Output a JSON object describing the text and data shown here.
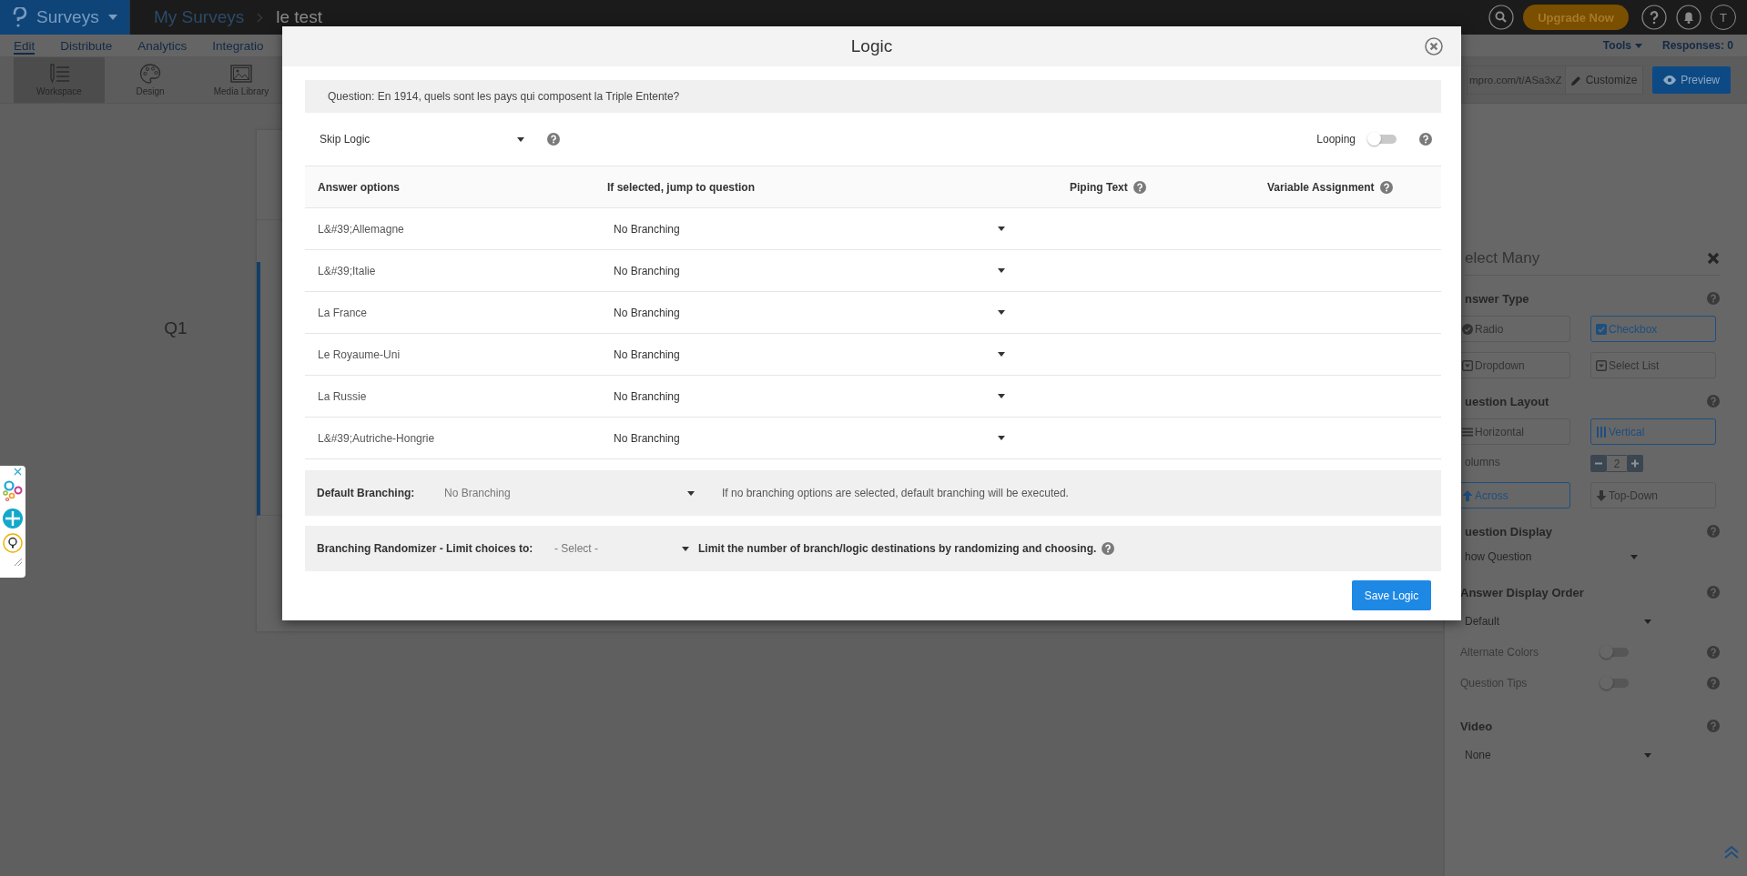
{
  "top_bar": {
    "product": "Surveys",
    "breadcrumbs": [
      "My Surveys",
      "le test"
    ],
    "upgrade_button": "Upgrade Now",
    "avatar_initial": "T"
  },
  "nav_tabs": [
    {
      "label": "Edit",
      "selected": true
    },
    {
      "label": "Distribute",
      "selected": false
    },
    {
      "label": "Analytics",
      "selected": false
    },
    {
      "label": "Integratio",
      "selected": false
    }
  ],
  "nav_right": {
    "tools": "Tools",
    "responses": "Responses: 0"
  },
  "toolbar": [
    {
      "label": "Workspace",
      "selected": true
    },
    {
      "label": "Design",
      "selected": false
    },
    {
      "label": "Media Library",
      "selected": false
    }
  ],
  "survey_link": {
    "url": "mpro.com/t/ASa3xZ",
    "customize": "Customize",
    "preview": "Preview"
  },
  "canvas": {
    "question_number": "Q1"
  },
  "properties_panel": {
    "title": "elect Many",
    "answer_type": {
      "heading": "nswer Type",
      "options": [
        {
          "label": "Radio",
          "selected": false
        },
        {
          "label": "Checkbox",
          "selected": true
        },
        {
          "label": "Dropdown",
          "selected": false
        },
        {
          "label": "Select List",
          "selected": false
        }
      ]
    },
    "question_layout": {
      "heading": "uestion Layout",
      "options": [
        {
          "label": "Horizontal",
          "selected": false
        },
        {
          "label": "Vertical",
          "selected": true
        }
      ],
      "columns_label": "olumns",
      "columns_value": "2",
      "direction": [
        {
          "label": "Across",
          "selected": true
        },
        {
          "label": "Top-Down",
          "selected": false
        }
      ]
    },
    "question_display": {
      "heading": "uestion Display",
      "value": "how Question"
    },
    "answer_display_order": {
      "heading": "Answer Display Order",
      "value": "Default"
    },
    "toggles": [
      {
        "label": "Alternate Colors",
        "on": false
      },
      {
        "label": "Question Tips",
        "on": false
      }
    ],
    "video": {
      "heading": "Video",
      "value": "None"
    }
  },
  "logic_dialog": {
    "title": "Logic",
    "question": "Question: En 1914, quels sont les pays qui composent la Triple Entente?",
    "logic_type": "Skip Logic",
    "looping_label": "Looping",
    "looping_on": false,
    "columns": [
      {
        "label": "Answer options",
        "help": false
      },
      {
        "label": "If selected, jump to question",
        "help": false
      },
      {
        "label": "Piping Text",
        "help": true
      },
      {
        "label": "Variable Assignment",
        "help": true
      }
    ],
    "rows": [
      {
        "answer": "L&#39;Allemagne",
        "jump": "No Branching"
      },
      {
        "answer": "L&#39;Italie",
        "jump": "No Branching"
      },
      {
        "answer": "La France",
        "jump": "No Branching"
      },
      {
        "answer": "Le Royaume-Uni",
        "jump": "No Branching"
      },
      {
        "answer": "La Russie",
        "jump": "No Branching"
      },
      {
        "answer": "L&#39;Autriche-Hongrie",
        "jump": "No Branching"
      }
    ],
    "default_branching": {
      "label": "Default Branching:",
      "value": "No Branching",
      "note": "If no branching options are selected, default branching will be executed."
    },
    "randomizer": {
      "label": "Branching Randomizer - Limit choices to:",
      "value": "- Select -",
      "note": "Limit the number of branch/logic destinations by randomizing and choosing."
    },
    "save_button": "Save Logic"
  }
}
